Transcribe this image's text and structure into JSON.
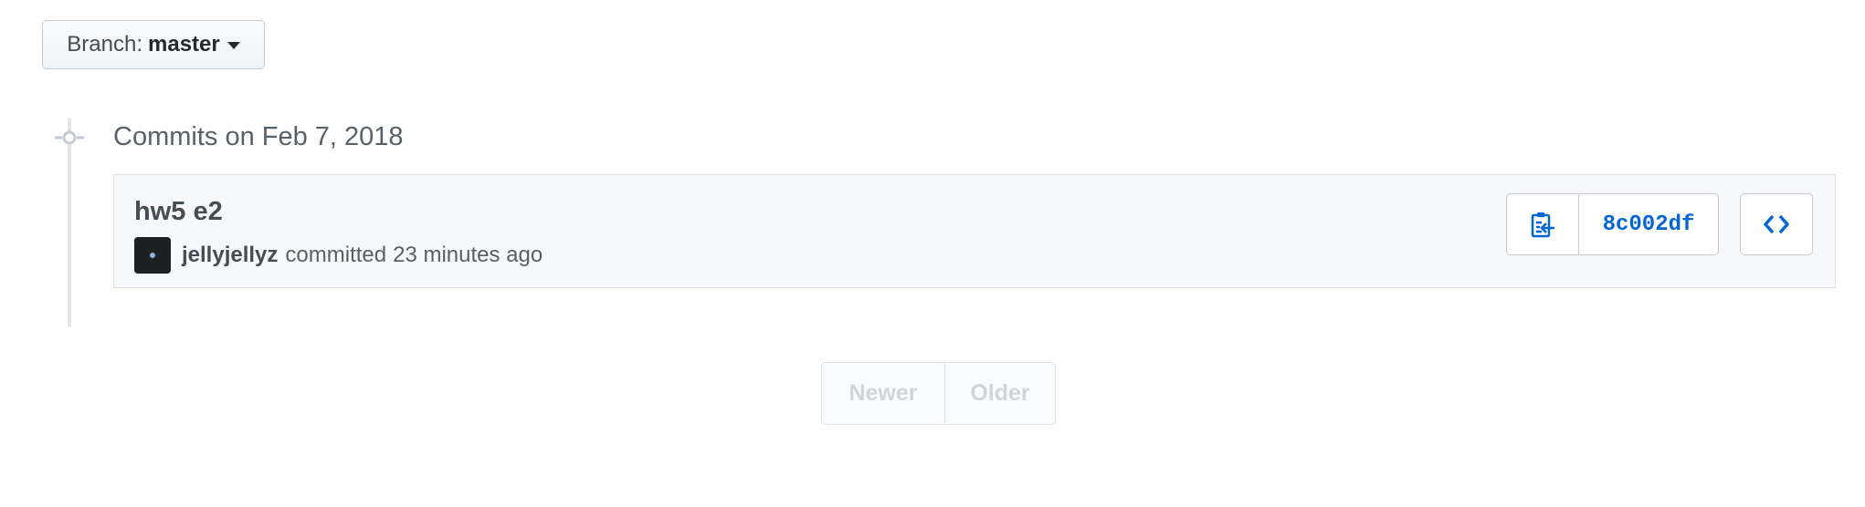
{
  "branch": {
    "prefix": "Branch:",
    "name": "master"
  },
  "commits_group": {
    "heading": "Commits on Feb 7, 2018"
  },
  "commit": {
    "title": "hw5 e2",
    "author": "jellyjellyz",
    "action": "committed",
    "time": "23 minutes ago",
    "sha": "8c002df"
  },
  "pagination": {
    "newer_label": "Newer",
    "older_label": "Older"
  },
  "icons": {
    "branch_caret": "caret-down-icon",
    "timeline_dot": "commit-node-icon",
    "copy_sha": "clippy-icon",
    "browse_files": "code-icon"
  },
  "colors": {
    "link_blue": "#0366d6",
    "row_background": "#f6f8fb",
    "disabled_text": "#d1d5da"
  }
}
